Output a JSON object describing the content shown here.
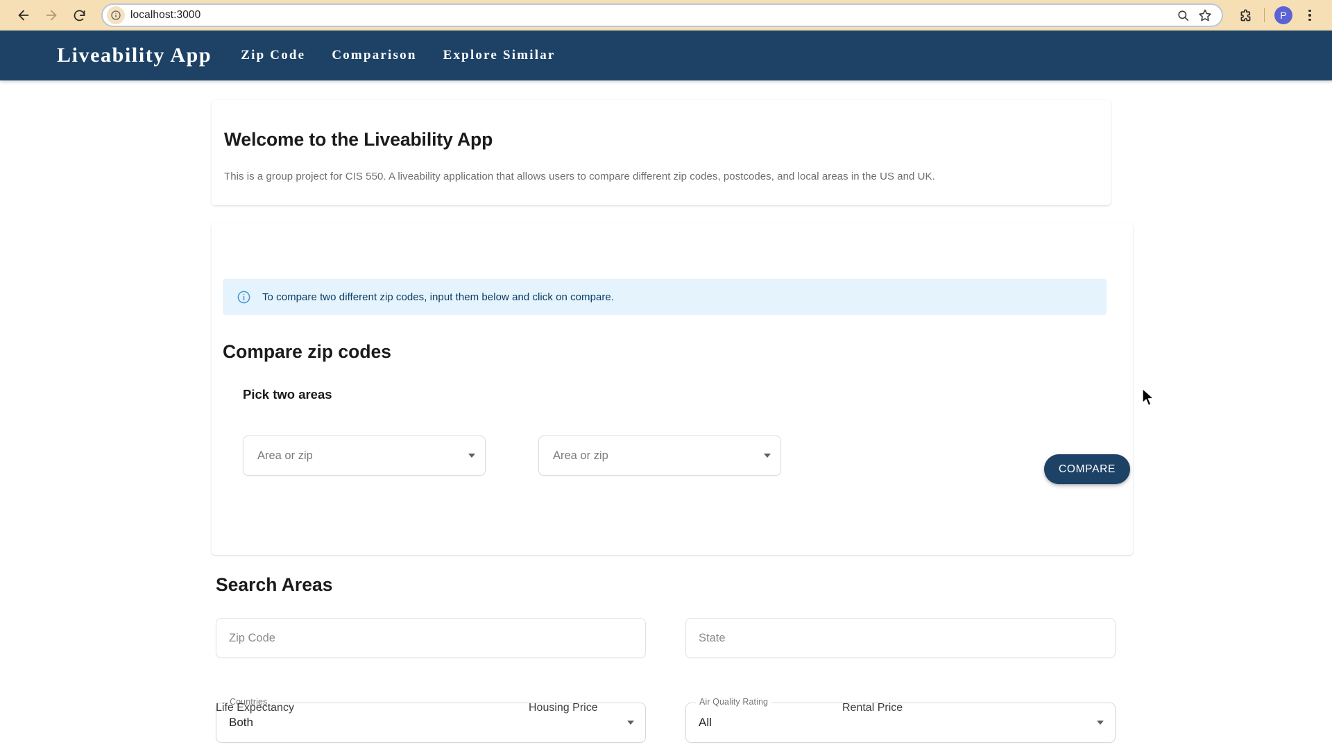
{
  "browser": {
    "back_icon": "back-arrow-icon",
    "forward_icon": "forward-arrow-icon",
    "reload_icon": "reload-icon",
    "site_info_icon": "site-info-icon",
    "url": "localhost:3000",
    "zoom_icon": "zoom-search-icon",
    "bookmark_icon": "bookmark-star-icon",
    "extensions_icon": "extensions-puzzle-icon",
    "profile_initial": "P",
    "menu_icon": "three-dot-menu-icon"
  },
  "appbar": {
    "brand": "Liveability App",
    "links": [
      {
        "label": "Zip Code"
      },
      {
        "label": "Comparison"
      },
      {
        "label": "Explore Similar"
      }
    ]
  },
  "welcome": {
    "title": "Welcome to the Liveability App",
    "description": "This is a group project for CIS 550. A liveability application that allows users to compare different zip codes, postcodes, and local areas in the US and UK."
  },
  "compare": {
    "title": "Compare zip codes",
    "alert_icon": "info-circle-icon",
    "alert_text": "To compare two different zip codes, input them below and click on compare.",
    "pick_label": "Pick two areas",
    "area_one_placeholder": "Area or zip",
    "area_two_placeholder": "Area or zip",
    "compare_button": "COMPARE"
  },
  "search": {
    "title": "Search Areas",
    "zip_placeholder": "Zip Code",
    "state_placeholder": "State",
    "countries_label": "Countries",
    "countries_value": "Both",
    "air_quality_label": "Air Quality Rating",
    "air_quality_value": "All"
  },
  "metrics": [
    {
      "label": "Life Expectancy"
    },
    {
      "label": "Housing Price"
    },
    {
      "label": "Rental Price"
    }
  ],
  "colors": {
    "navy": "#1d4266",
    "chrome_bg": "#f7dfb5",
    "alert_bg": "#e5f3fc",
    "profile": "#5b62d4"
  }
}
